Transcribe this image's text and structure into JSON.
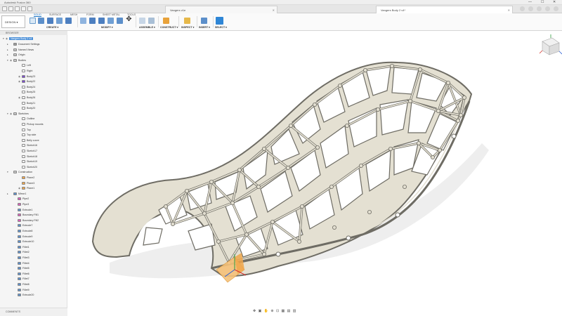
{
  "window_title": "Autodesk Fusion 360",
  "window_controls": [
    "—",
    "☐",
    "✕"
  ],
  "tabs": [
    {
      "label": "Vangers v1e"
    },
    {
      "label": "Vangers Body 2 v4*"
    }
  ],
  "toolbar": {
    "workspace": "DESIGN ▾",
    "menu_tabs": [
      "SOLID",
      "SURFACE",
      "MESH",
      "FORM",
      "SHEET METAL",
      "TOOLS"
    ],
    "groups": [
      "CREATE ▾",
      "MODIFY ▾",
      "ASSEMBLE ▾",
      "CONSTRUCT ▾",
      "INSPECT ▾",
      "INSERT ▾",
      "SELECT ▾"
    ]
  },
  "browser": {
    "header": "BROWSER",
    "root": "Vangers Body 2 v4",
    "items": [
      "Document Settings",
      "Named Views",
      "Origin",
      "Bodies",
      "Left",
      "Right",
      "Body23",
      "Body22",
      "Body24",
      "Body25",
      "Body26",
      "Body21",
      "Body20",
      "Sketches",
      "Outline",
      "Pickup mounts",
      "Top",
      "Top side",
      "Belly curve",
      "Sketch16",
      "Sketch17",
      "Sketch18",
      "Sketch19",
      "Sketch20",
      "Construction",
      "Plane2",
      "Plane3",
      "Plane1",
      "Mirror1",
      "Pipe2",
      "Pipe3",
      "Extrude1",
      "Boundary Fill1",
      "Boundary Fill2",
      "Extrude7",
      "Extrude8",
      "Extrude9",
      "Extrude10",
      "Fillet1",
      "Fillet2",
      "Fillet3",
      "Fillet4",
      "Fillet5",
      "Fillet6",
      "Fillet7",
      "Fillet8",
      "Fillet9",
      "Extrude20"
    ]
  },
  "comments": "COMMENTS",
  "colors": {
    "accent": "#1a76c8",
    "lattice": "#e2ded0",
    "lattice_edge": "#6e6c64",
    "selection": "#4a8fd8"
  }
}
